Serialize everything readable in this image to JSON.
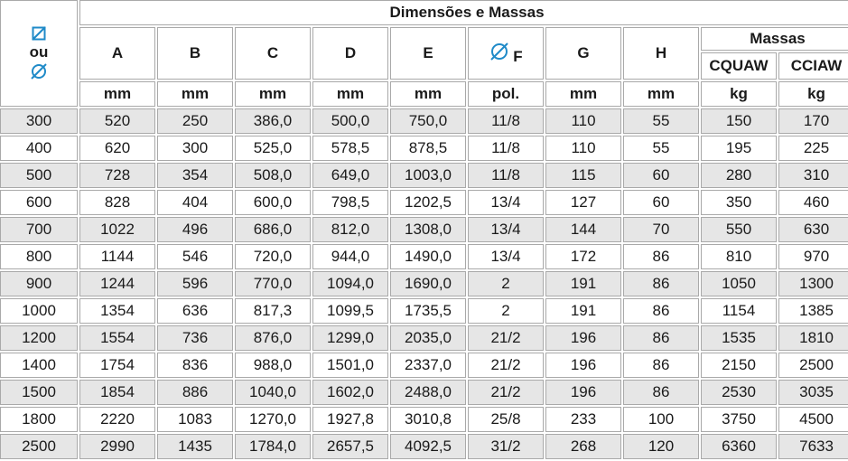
{
  "table": {
    "title": "Dimensões e Massas",
    "corner": {
      "top_icon": "square-diameter-icon",
      "middle": "ou",
      "bottom_icon": "diameter-icon"
    },
    "columns": [
      "A",
      "B",
      "C",
      "D",
      "E",
      "F",
      "G",
      "H"
    ],
    "f_icon": "diameter-icon",
    "mass_group": "Massas",
    "mass_columns": [
      "CQUAW",
      "CCIAW"
    ],
    "units": [
      "mm",
      "mm",
      "mm",
      "mm",
      "mm",
      "pol.",
      "mm",
      "mm",
      "kg",
      "kg"
    ],
    "rows": [
      [
        "300",
        "520",
        "250",
        "386,0",
        "500,0",
        "750,0",
        "11/8",
        "110",
        "55",
        "150",
        "170"
      ],
      [
        "400",
        "620",
        "300",
        "525,0",
        "578,5",
        "878,5",
        "11/8",
        "110",
        "55",
        "195",
        "225"
      ],
      [
        "500",
        "728",
        "354",
        "508,0",
        "649,0",
        "1003,0",
        "11/8",
        "115",
        "60",
        "280",
        "310"
      ],
      [
        "600",
        "828",
        "404",
        "600,0",
        "798,5",
        "1202,5",
        "13/4",
        "127",
        "60",
        "350",
        "460"
      ],
      [
        "700",
        "1022",
        "496",
        "686,0",
        "812,0",
        "1308,0",
        "13/4",
        "144",
        "70",
        "550",
        "630"
      ],
      [
        "800",
        "1144",
        "546",
        "720,0",
        "944,0",
        "1490,0",
        "13/4",
        "172",
        "86",
        "810",
        "970"
      ],
      [
        "900",
        "1244",
        "596",
        "770,0",
        "1094,0",
        "1690,0",
        "2",
        "191",
        "86",
        "1050",
        "1300"
      ],
      [
        "1000",
        "1354",
        "636",
        "817,3",
        "1099,5",
        "1735,5",
        "2",
        "191",
        "86",
        "1154",
        "1385"
      ],
      [
        "1200",
        "1554",
        "736",
        "876,0",
        "1299,0",
        "2035,0",
        "21/2",
        "196",
        "86",
        "1535",
        "1810"
      ],
      [
        "1400",
        "1754",
        "836",
        "988,0",
        "1501,0",
        "2337,0",
        "21/2",
        "196",
        "86",
        "2150",
        "2500"
      ],
      [
        "1500",
        "1854",
        "886",
        "1040,0",
        "1602,0",
        "2488,0",
        "21/2",
        "196",
        "86",
        "2530",
        "3035"
      ],
      [
        "1800",
        "2220",
        "1083",
        "1270,0",
        "1927,8",
        "3010,8",
        "25/8",
        "233",
        "100",
        "3750",
        "4500"
      ],
      [
        "2500",
        "2990",
        "1435",
        "1784,0",
        "2657,5",
        "4092,5",
        "31/2",
        "268",
        "120",
        "6360",
        "7633"
      ]
    ]
  }
}
